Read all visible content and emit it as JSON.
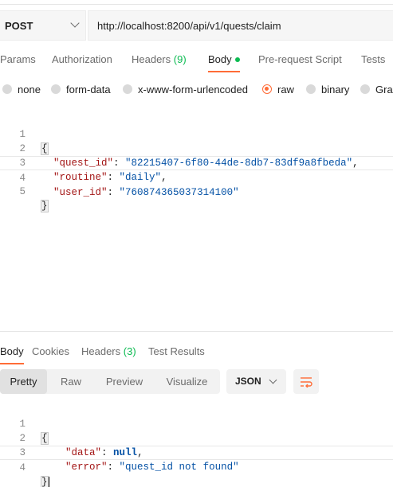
{
  "request": {
    "method": "POST",
    "url": "http://localhost:8200/api/v1/quests/claim"
  },
  "request_tabs": [
    {
      "label": "Params"
    },
    {
      "label": "Authorization"
    },
    {
      "label": "Headers",
      "count": "(9)"
    },
    {
      "label": "Body",
      "active": true
    },
    {
      "label": "Pre-request Script"
    },
    {
      "label": "Tests"
    }
  ],
  "body_types": [
    {
      "label": "none"
    },
    {
      "label": "form-data"
    },
    {
      "label": "x-www-form-urlencoded"
    },
    {
      "label": "raw",
      "selected": true
    },
    {
      "label": "binary"
    },
    {
      "label": "Grap"
    }
  ],
  "request_body": {
    "line_numbers": [
      "1",
      "2",
      "3",
      "4",
      "5"
    ],
    "open_brace": "{",
    "close_brace": "}",
    "fields": [
      {
        "key": "\"quest_id\"",
        "value": "\"82215407-6f80-44de-8db7-83df9a8fbeda\"",
        "trail": ","
      },
      {
        "key": "\"routine\"",
        "value": "\"daily\"",
        "trail": ","
      },
      {
        "key": "\"user_id\"",
        "value": "\"760874365037314100\"",
        "trail": ""
      }
    ]
  },
  "response_tabs": [
    {
      "label": "Body",
      "active": true
    },
    {
      "label": "Cookies"
    },
    {
      "label": "Headers",
      "count": "(3)"
    },
    {
      "label": "Test Results"
    }
  ],
  "response_view": {
    "modes": [
      "Pretty",
      "Raw",
      "Preview",
      "Visualize"
    ],
    "active_mode": "Pretty",
    "language": "JSON",
    "wrap_icon": "wrap-lines-icon"
  },
  "response_body": {
    "line_numbers": [
      "1",
      "2",
      "3",
      "4"
    ],
    "open_brace": "{",
    "close_brace": "}",
    "fields": [
      {
        "key": "\"data\"",
        "value": "null",
        "trail": ","
      },
      {
        "key": "\"error\"",
        "value": "\"quest_id not found\"",
        "trail": ""
      }
    ]
  },
  "colors": {
    "accent": "#ff6c37",
    "count_green": "#0cbb52",
    "json_key": "#a31515",
    "json_string": "#0451a5"
  }
}
